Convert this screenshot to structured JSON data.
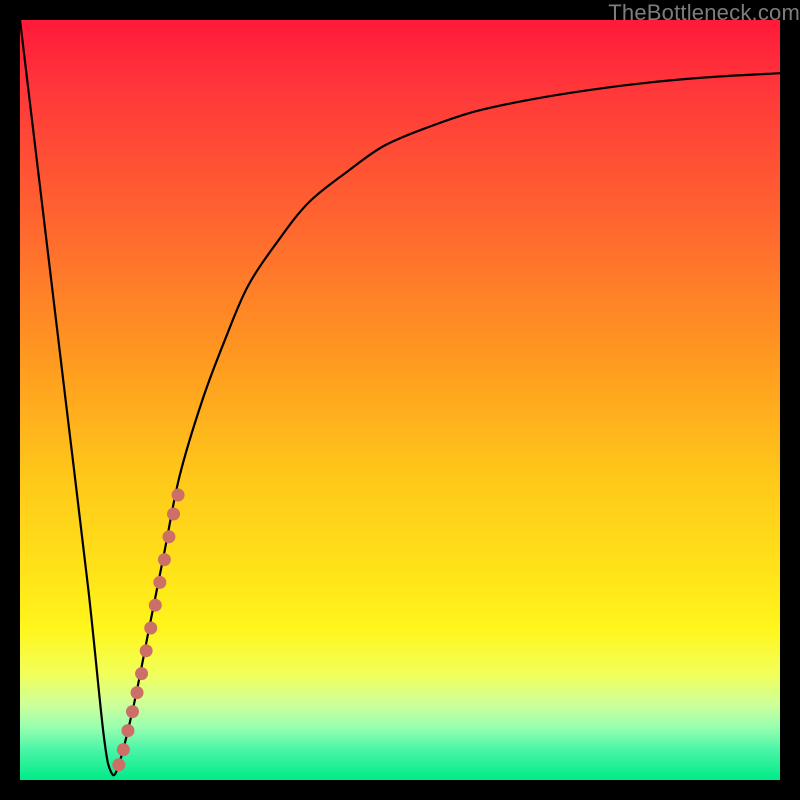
{
  "watermark": {
    "text": "TheBottleneck.com"
  },
  "colors": {
    "black": "#000000",
    "curve": "#000000",
    "dot": "#cc6f66",
    "gradient_stops": [
      {
        "pos": 0.0,
        "color": "#ff1a3a"
      },
      {
        "pos": 0.1,
        "color": "#ff3a3a"
      },
      {
        "pos": 0.28,
        "color": "#ff6a2f"
      },
      {
        "pos": 0.45,
        "color": "#ff9b20"
      },
      {
        "pos": 0.6,
        "color": "#ffc81a"
      },
      {
        "pos": 0.72,
        "color": "#ffe219"
      },
      {
        "pos": 0.8,
        "color": "#fff61c"
      },
      {
        "pos": 0.86,
        "color": "#f3ff5a"
      },
      {
        "pos": 0.9,
        "color": "#cfff9a"
      },
      {
        "pos": 0.93,
        "color": "#9affb0"
      },
      {
        "pos": 0.96,
        "color": "#4cf5a8"
      },
      {
        "pos": 1.0,
        "color": "#00eb88"
      }
    ]
  },
  "chart_data": {
    "type": "line",
    "title": "",
    "xlabel": "",
    "ylabel": "",
    "xlim": [
      0,
      100
    ],
    "ylim": [
      0,
      100
    ],
    "series": [
      {
        "name": "bottleneck-curve",
        "x": [
          0,
          3,
          6,
          9,
          11,
          12,
          13,
          15,
          17,
          19,
          21,
          24,
          27,
          30,
          34,
          38,
          43,
          48,
          54,
          60,
          67,
          75,
          83,
          91,
          100
        ],
        "y": [
          100,
          75,
          50,
          25,
          6,
          1,
          2,
          10,
          20,
          30,
          40,
          50,
          58,
          65,
          71,
          76,
          80,
          83.5,
          86,
          88,
          89.5,
          90.8,
          91.8,
          92.5,
          93
        ]
      },
      {
        "name": "highlight-dots",
        "x": [
          13.0,
          13.6,
          14.2,
          14.8,
          15.4,
          16.0,
          16.6,
          17.2,
          17.8,
          18.4,
          19.0,
          19.6,
          20.2,
          20.8
        ],
        "y": [
          2.0,
          4.0,
          6.5,
          9.0,
          11.5,
          14.0,
          17.0,
          20.0,
          23.0,
          26.0,
          29.0,
          32.0,
          35.0,
          37.5
        ]
      }
    ]
  }
}
